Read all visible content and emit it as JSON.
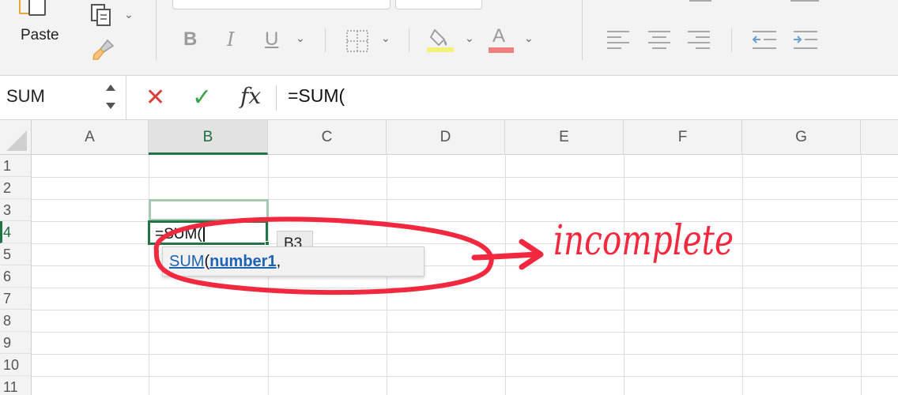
{
  "ribbon": {
    "paste_label": "Paste",
    "bold": "B",
    "italic": "I",
    "underline": "U",
    "font_color_glyph": "A",
    "icons": [
      "paste-icon",
      "copy-icon",
      "format-painter-icon",
      "border-icon",
      "fill-color-icon",
      "font-color-icon",
      "align-left-icon",
      "align-center-icon",
      "align-right-icon",
      "decrease-indent-icon",
      "increase-indent-icon"
    ],
    "colors": {
      "highlight": "#f5f07a",
      "font_color": "#f08080",
      "paste_accent": "#e8a33a"
    }
  },
  "formula_bar": {
    "name_box": "SUM",
    "cancel_glyph": "✕",
    "enter_glyph": "✓",
    "fx_label": "fx",
    "formula": "=SUM(",
    "colors": {
      "cancel": "#dc3c3c",
      "enter": "#3aa34a"
    }
  },
  "grid": {
    "columns": [
      "A",
      "B",
      "C",
      "D",
      "E",
      "F",
      "G"
    ],
    "selected_column": "B",
    "rows": [
      "1",
      "2",
      "3",
      "4",
      "5",
      "6",
      "7",
      "8",
      "9",
      "10",
      "11"
    ],
    "selected_row": "4",
    "editing_cell_text": "=SUM(",
    "accent": "#227447"
  },
  "tooltips": {
    "ref": "B3",
    "func_name": "SUM",
    "open_paren": "(",
    "arg": "number1",
    "comma": ","
  },
  "annotation": {
    "text": "incomplete",
    "color": "#f2283f"
  }
}
